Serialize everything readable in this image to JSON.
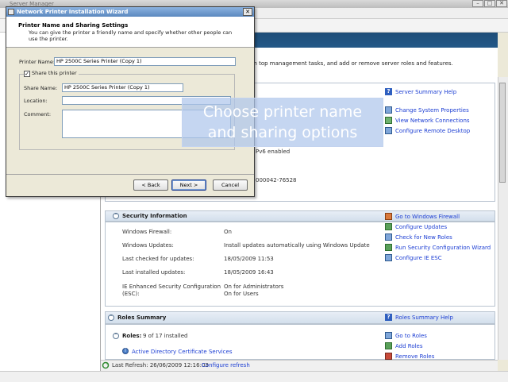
{
  "background_window": {
    "title": "Server Manager",
    "header_text": "orm top management tasks, and add or remove server roles and features.",
    "summary_help_link": "Server Summary Help",
    "server_tasks": [
      {
        "label": "Change System Properties",
        "icon": "computer-icon"
      },
      {
        "label": "View Network Connections",
        "icon": "network-icon"
      },
      {
        "label": "Configure Remote Desktop",
        "icon": "remote-desktop-icon"
      }
    ],
    "partial_texts": [
      "Pv6 enabled",
      "000042-76528"
    ],
    "security": {
      "title": "Security Information",
      "rows": [
        {
          "label": "Windows Firewall:",
          "value": "On"
        },
        {
          "label": "Windows Updates:",
          "value": "Install updates automatically using Windows Update"
        },
        {
          "label": "Last checked for updates:",
          "value": "18/05/2009 11:53"
        },
        {
          "label": "Last installed updates:",
          "value": "18/05/2009 16:43"
        },
        {
          "label": "IE Enhanced Security Configuration (ESC):",
          "value": "On for Administrators",
          "value2": "On for Users"
        }
      ],
      "tasks": [
        "Go to Windows Firewall",
        "Configure Updates",
        "Check for New Roles",
        "Run Security Configuration Wizard",
        "Configure IE ESC"
      ]
    },
    "roles": {
      "title": "Roles Summary",
      "help_link": "Roles Summary Help",
      "count_label": "Roles:",
      "count_value": "9 of 17 installed",
      "first_role": "Active Directory Certificate Services",
      "tasks": [
        "Go to Roles",
        "Add Roles",
        "Remove Roles"
      ]
    },
    "status": {
      "last_refresh": "Last Refresh: 26/06/2009 12:16:03",
      "configure_refresh": "Configure refresh"
    }
  },
  "wizard": {
    "title": "Network Printer Installation Wizard",
    "close_glyph": "✕",
    "header_title": "Printer Name and Sharing Settings",
    "header_desc": "You can give the printer a friendly name and specify whether other people can use the printer.",
    "printer_name_label": "Printer Name:",
    "printer_name_value": "HP 2500C Series Printer (Copy 1)",
    "share_checkbox_label": "Share this printer",
    "share_checked": true,
    "share_name_label": "Share Name:",
    "share_name_value": "HP 2500C Series Printer (Copy 1)",
    "location_label": "Location:",
    "location_value": "",
    "comment_label": "Comment:",
    "comment_value": "",
    "back_label": "< Back",
    "next_label": "Next >",
    "cancel_label": "Cancel"
  },
  "callout": {
    "line1": "Choose printer name",
    "line2": "and sharing options"
  }
}
